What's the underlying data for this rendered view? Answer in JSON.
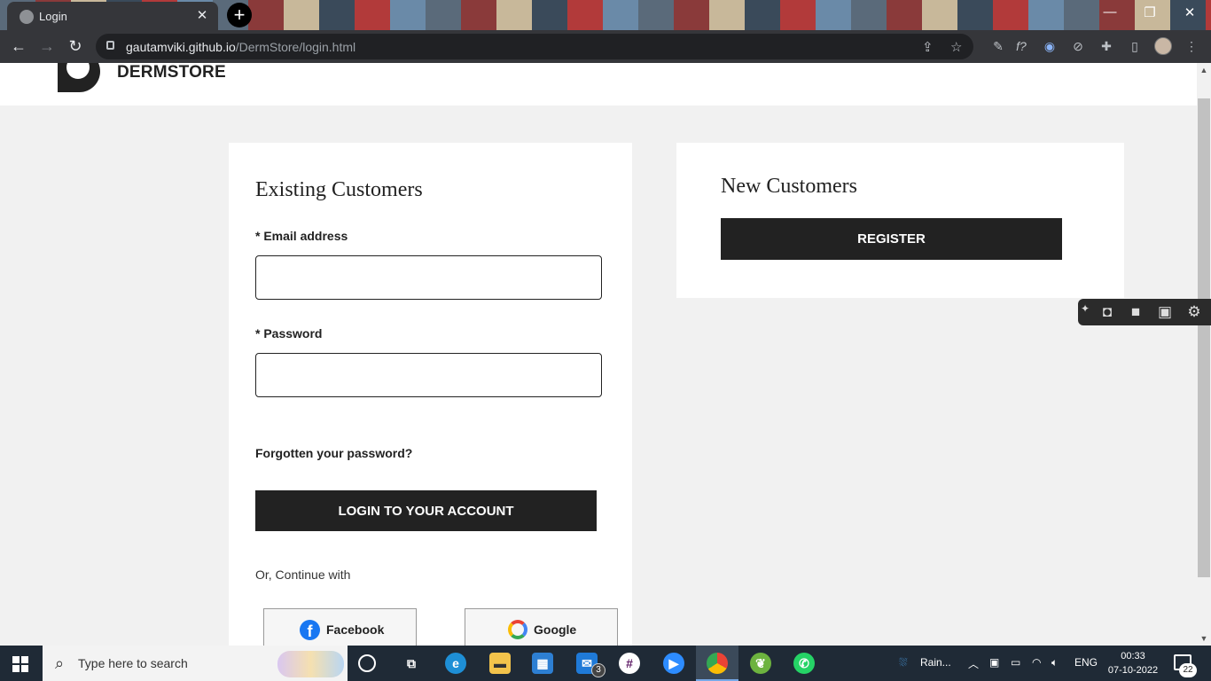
{
  "browser": {
    "tab_title": "Login",
    "tab_close": "✕",
    "new_tab": "+",
    "url_host": "gautamviki.github.io",
    "url_path": "/DermStore/login.html",
    "window_controls": [
      "—",
      "❐",
      "✕"
    ]
  },
  "site": {
    "brand": "DERMSTORE"
  },
  "existing": {
    "title": "Existing Customers",
    "email_label": "* Email address",
    "email_value": "",
    "password_label": "* Password",
    "password_value": "",
    "forgot_link": "Forgotten your password?",
    "login_button": "LOGIN TO YOUR ACCOUNT",
    "continue_text": "Or, Continue with",
    "facebook_label": "Facebook",
    "google_label": "Google"
  },
  "new_customers": {
    "title": "New Customers",
    "register_button": "REGISTER"
  },
  "taskbar": {
    "search_placeholder": "Type here to search",
    "mail_badge": "3",
    "weather": "Rain...",
    "language": "ENG",
    "time": "00:33",
    "date": "07-10-2022",
    "notification_count": "22"
  },
  "colors": {
    "button_bg": "#222222",
    "page_bg": "#f1f1f1",
    "card_bg": "#ffffff",
    "facebook_blue": "#1877f2"
  }
}
